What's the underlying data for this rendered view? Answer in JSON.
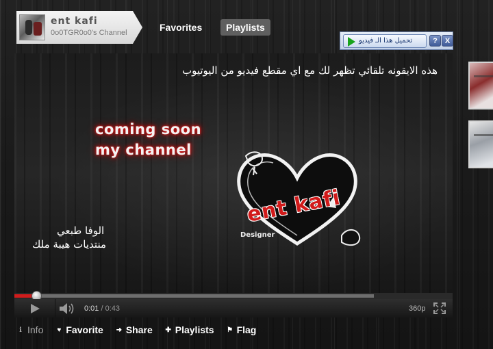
{
  "channel": {
    "name": "ent kafi",
    "subtitle": "0o0TGR0o0's Channel"
  },
  "nav": {
    "favorites_label": "Favorites",
    "playlists_label": "Playlists"
  },
  "download_toolbar": {
    "button_label": "تحميل هذا الـ فيديو",
    "help_label": "?",
    "close_label": "X"
  },
  "video": {
    "overlay_text_ar": "هذه الايقونه تلقائي تظهر لك مع اي مقطع فيديو من اليوتيوب",
    "coming_line_1": "coming soon",
    "coming_line_2": "my channel",
    "logo_text": "ent kafi",
    "logo_designer": "Designer",
    "signature_line_1": "الوفا طبعي",
    "signature_line_2": "منتديات هيبة ملك"
  },
  "player": {
    "current_time": "0:01",
    "duration": "/ 0:43",
    "quality": "360p",
    "progress_played_fraction": 0.05,
    "progress_buffered_fraction": 0.82
  },
  "actions": {
    "info": "Info",
    "favorite": "Favorite",
    "share": "Share",
    "playlists": "Playlists",
    "flag": "Flag"
  },
  "icons": {
    "info": "info-icon",
    "favorite": "heart-icon",
    "share": "arrow-right-icon",
    "playlists": "plus-icon",
    "flag": "flag-icon"
  },
  "colors": {
    "progress_played": "#d01c1c",
    "brand_red": "#d11a1a",
    "toolbar_blue": "#6f89b7"
  }
}
